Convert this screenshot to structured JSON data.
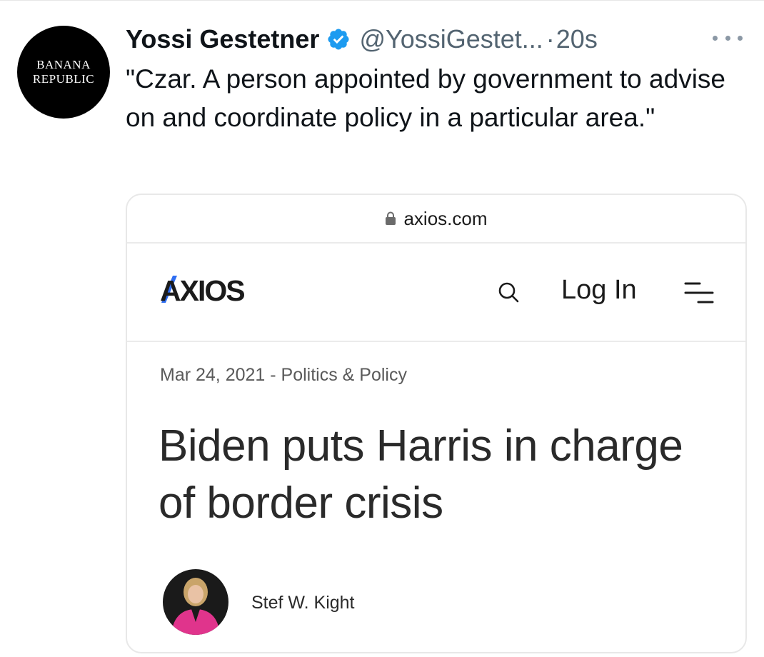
{
  "tweet": {
    "avatar": {
      "line1": "BANANA",
      "line2": "REPUBLIC"
    },
    "author_name": "Yossi Gestetner",
    "handle": "@YossiGestet...",
    "separator": "·",
    "time": "20s",
    "text": "\"Czar. A person appointed by government to advise on and coordinate policy in a particular area.\"",
    "icons": {
      "verified": "verified-badge-icon",
      "more": "more-options-icon"
    },
    "colors": {
      "verified": "#1d9bf0",
      "secondary_text": "#536471"
    }
  },
  "link_card": {
    "domain": "axios.com",
    "site": {
      "logo": "AXIOS",
      "login_label": "Log In",
      "icons": {
        "search": "search-icon",
        "menu": "menu-icon",
        "lock": "lock-icon"
      },
      "accent": "#2f6ef2"
    },
    "article": {
      "date": "Mar 24, 2021",
      "meta_separator": " - ",
      "category": "Politics & Policy",
      "headline": "Biden puts Harris in charge of border crisis",
      "author": "Stef W. Kight"
    }
  }
}
